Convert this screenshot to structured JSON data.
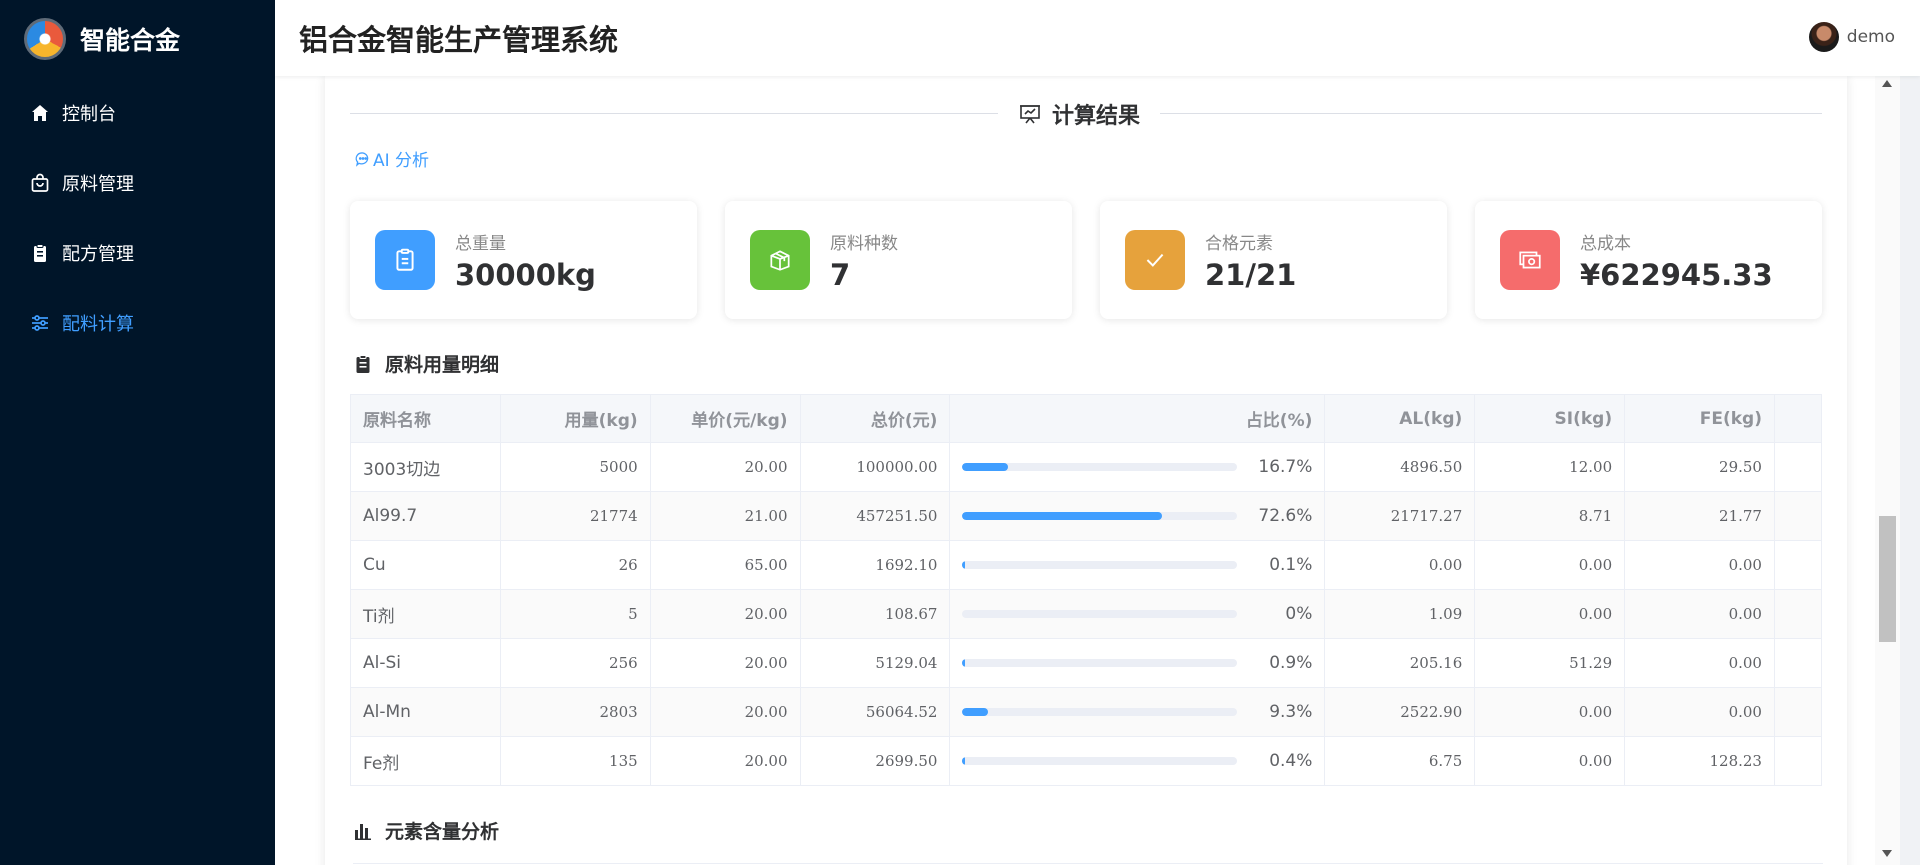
{
  "app": {
    "logo_text": "智能合金",
    "title": "铝合金智能生产管理系统",
    "user": "demo"
  },
  "sidebar": {
    "items": [
      {
        "label": "控制台",
        "icon": "home-icon",
        "active": false
      },
      {
        "label": "原料管理",
        "icon": "shopping-bag-icon",
        "active": false
      },
      {
        "label": "配方管理",
        "icon": "clipboard-icon",
        "active": false
      },
      {
        "label": "配料计算",
        "icon": "sliders-icon",
        "active": true
      }
    ]
  },
  "result": {
    "title": "计算结果",
    "ai_label": "AI 分析",
    "stats": [
      {
        "label": "总重量",
        "value": "30000kg",
        "icon": "clipboard-icon",
        "color": "#409eff"
      },
      {
        "label": "原料种数",
        "value": "7",
        "icon": "box-icon",
        "color": "#67c23a"
      },
      {
        "label": "合格元素",
        "value": "21/21",
        "icon": "check-icon",
        "color": "#e6a23c"
      },
      {
        "label": "总成本",
        "value": "¥622945.33",
        "icon": "money-icon",
        "color": "#f56c6c"
      }
    ]
  },
  "materials": {
    "title": "原料用量明细",
    "columns": [
      "原料名称",
      "用量(kg)",
      "单价(元/kg)",
      "总价(元)",
      "占比(%)",
      "AL(kg)",
      "SI(kg)",
      "FE(kg)"
    ],
    "rows": [
      {
        "name": "3003切边",
        "qty": "5000",
        "price": "20.00",
        "total": "100000.00",
        "pct": "16.7%",
        "pct_value": 16.7,
        "al": "4896.50",
        "si": "12.00",
        "fe": "29.50"
      },
      {
        "name": "Al99.7",
        "qty": "21774",
        "price": "21.00",
        "total": "457251.50",
        "pct": "72.6%",
        "pct_value": 72.6,
        "al": "21717.27",
        "si": "8.71",
        "fe": "21.77"
      },
      {
        "name": "Cu",
        "qty": "26",
        "price": "65.00",
        "total": "1692.10",
        "pct": "0.1%",
        "pct_value": 0.1,
        "al": "0.00",
        "si": "0.00",
        "fe": "0.00"
      },
      {
        "name": "Ti剂",
        "qty": "5",
        "price": "20.00",
        "total": "108.67",
        "pct": "0%",
        "pct_value": 0,
        "al": "1.09",
        "si": "0.00",
        "fe": "0.00"
      },
      {
        "name": "Al-Si",
        "qty": "256",
        "price": "20.00",
        "total": "5129.04",
        "pct": "0.9%",
        "pct_value": 0.9,
        "al": "205.16",
        "si": "51.29",
        "fe": "0.00"
      },
      {
        "name": "Al-Mn",
        "qty": "2803",
        "price": "20.00",
        "total": "56064.52",
        "pct": "9.3%",
        "pct_value": 9.3,
        "al": "2522.90",
        "si": "0.00",
        "fe": "0.00"
      },
      {
        "name": "Fe剂",
        "qty": "135",
        "price": "20.00",
        "total": "2699.50",
        "pct": "0.4%",
        "pct_value": 0.4,
        "al": "6.75",
        "si": "0.00",
        "fe": "128.23"
      }
    ]
  },
  "elements": {
    "title": "元素含量分析"
  }
}
